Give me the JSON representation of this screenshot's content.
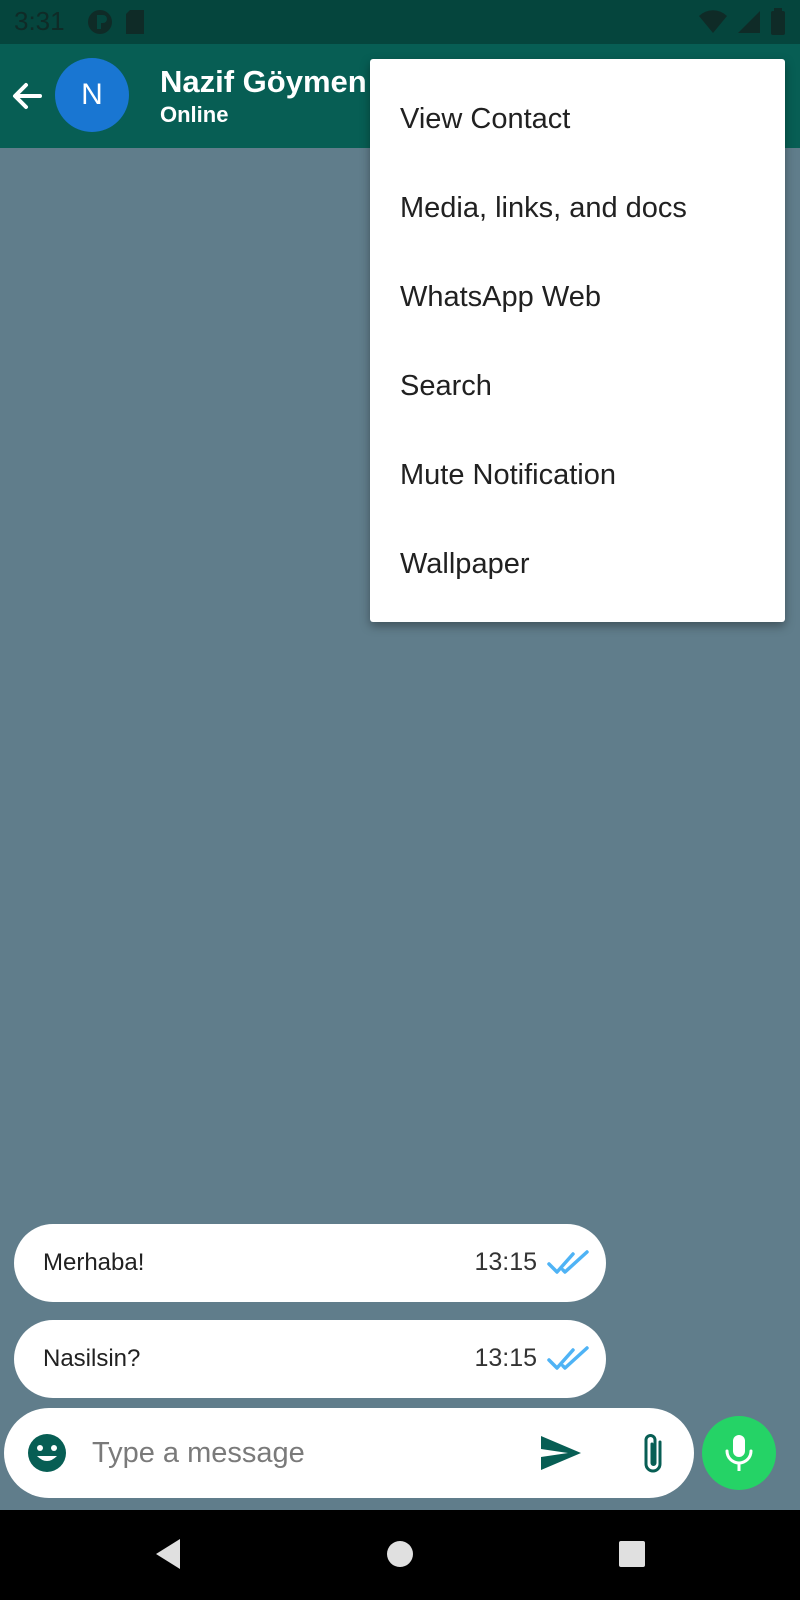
{
  "status_bar": {
    "time": "3:31",
    "left_icons": [
      "p-badge-icon",
      "sd-card-icon"
    ],
    "right_icons": [
      "wifi-icon",
      "signal-icon",
      "battery-icon"
    ]
  },
  "header": {
    "avatar_letter": "N",
    "contact_name": "Nazif Göymen",
    "contact_status": "Online",
    "colors": {
      "app_bar": "#075e54",
      "avatar": "#1976d2"
    }
  },
  "overflow_menu": {
    "items": [
      {
        "label": "View Contact"
      },
      {
        "label": "Media, links, and docs"
      },
      {
        "label": "WhatsApp Web"
      },
      {
        "label": "Search"
      },
      {
        "label": "Mute Notification"
      },
      {
        "label": "Wallpaper"
      }
    ]
  },
  "messages": [
    {
      "text": "Merhaba!",
      "time": "13:15",
      "status_icon": "double-check-icon"
    },
    {
      "text": "Nasilsin?",
      "time": "13:15",
      "status_icon": "double-check-icon"
    }
  ],
  "composer": {
    "placeholder": "Type a message",
    "icons": [
      "emoji-icon",
      "send-icon",
      "attach-icon",
      "mic-icon"
    ],
    "colors": {
      "mic_button": "#25d366",
      "accent": "#075e54"
    }
  },
  "navigation": {
    "buttons": [
      "back-triangle-icon",
      "home-circle-icon",
      "recents-square-icon"
    ]
  },
  "colors": {
    "chat_background": "#607d8b",
    "read_check": "#4fb3f5"
  }
}
